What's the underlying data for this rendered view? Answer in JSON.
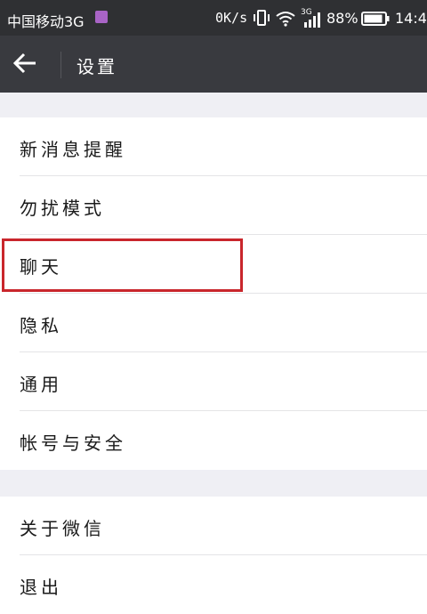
{
  "status_bar": {
    "carrier": "中国移动3G",
    "net_speed": "0K/s",
    "network_type": "3G",
    "battery_percent": "88%",
    "time": "14:4",
    "icons": [
      "sim-icon",
      "vibrate-icon",
      "wifi-icon",
      "signal-icon",
      "battery-icon"
    ]
  },
  "header": {
    "back_icon": "back-arrow-icon",
    "title": "设置"
  },
  "settings": {
    "group1": [
      {
        "label": "新消息提醒"
      },
      {
        "label": "勿扰模式"
      },
      {
        "label": "聊天"
      },
      {
        "label": "隐私"
      },
      {
        "label": "通用"
      },
      {
        "label": "帐号与安全"
      }
    ],
    "group2": [
      {
        "label": "关于微信"
      },
      {
        "label": "退出"
      }
    ]
  },
  "highlight": {
    "target": "聊天",
    "color": "#c9262c"
  },
  "colors": {
    "status_bar_bg": "#2f3033",
    "title_bar_bg": "#393a3f",
    "page_bg": "#efeff4",
    "row_bg": "#ffffff"
  }
}
